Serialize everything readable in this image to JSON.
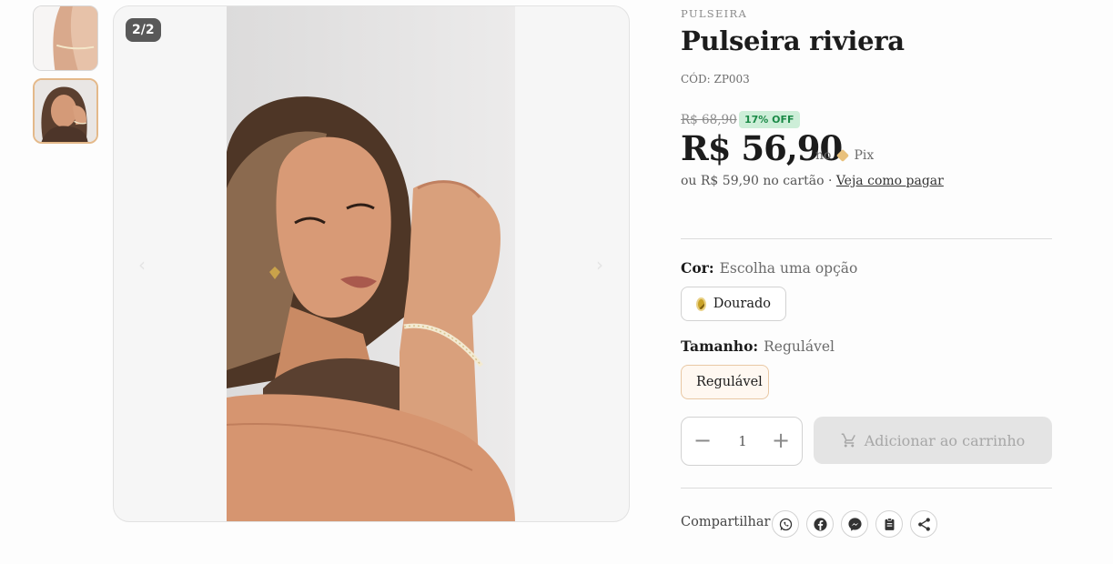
{
  "gallery": {
    "counter": "2/2",
    "prev_icon": "‹",
    "next_icon": "›",
    "thumbnails": [
      "thumb-arm-bracelet",
      "thumb-woman-bracelet"
    ]
  },
  "product": {
    "category": "PULSEIRA",
    "title": "Pulseira riviera",
    "code": "CÓD: ZP003",
    "old_price": "R$ 68,90",
    "discount": "17% OFF",
    "price": "R$ 56,90",
    "pix_prefix": "no",
    "pix_label": "Pix",
    "card_text": "ou R$ 59,90 no cartão ·",
    "card_link": "Veja como pagar"
  },
  "options": {
    "color": {
      "label": "Cor:",
      "value": "Escolha uma opção",
      "choices": [
        "Dourado"
      ]
    },
    "size": {
      "label": "Tamanho:",
      "value": "Regulável",
      "choices": [
        "Regulável"
      ]
    }
  },
  "purchase": {
    "qty_minus": "−",
    "qty_plus": "+",
    "quantity": "1",
    "add_to_cart": "Adicionar ao carrinho"
  },
  "share": {
    "label": "Compartilhar",
    "buttons": [
      "whatsapp-icon",
      "facebook-icon",
      "messenger-icon",
      "clipboard-icon",
      "share-icon"
    ]
  },
  "colors": {
    "accent_border": "#e4b98a",
    "discount_bg": "#cdeed8",
    "discount_text": "#1b8a47",
    "button_disabled": "#e4e4e4"
  }
}
